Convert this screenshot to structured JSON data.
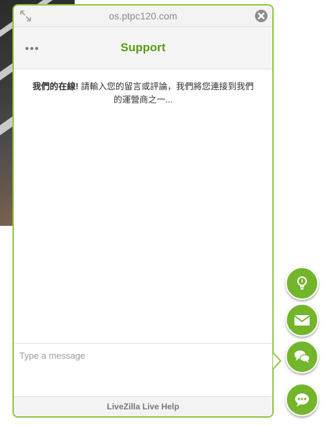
{
  "window": {
    "title": "os.ptpc120.com"
  },
  "header": {
    "title": "Support"
  },
  "welcome": {
    "bold": "我們的在線!",
    "text": " 請輸入您的留言或評論，我們將您連接到我們的運營商之一..."
  },
  "input": {
    "placeholder": "Type a message",
    "value": ""
  },
  "footer": {
    "text": "LiveZilla Live Help"
  },
  "side_buttons": [
    {
      "icon": "lightbulb-icon"
    },
    {
      "icon": "envelope-icon"
    },
    {
      "icon": "chat-bubbles-icon"
    },
    {
      "icon": "speech-bubble-icon"
    }
  ],
  "colors": {
    "accent": "#8cc63f",
    "title_green": "#5d9c16",
    "button_green": "#73b52b"
  }
}
